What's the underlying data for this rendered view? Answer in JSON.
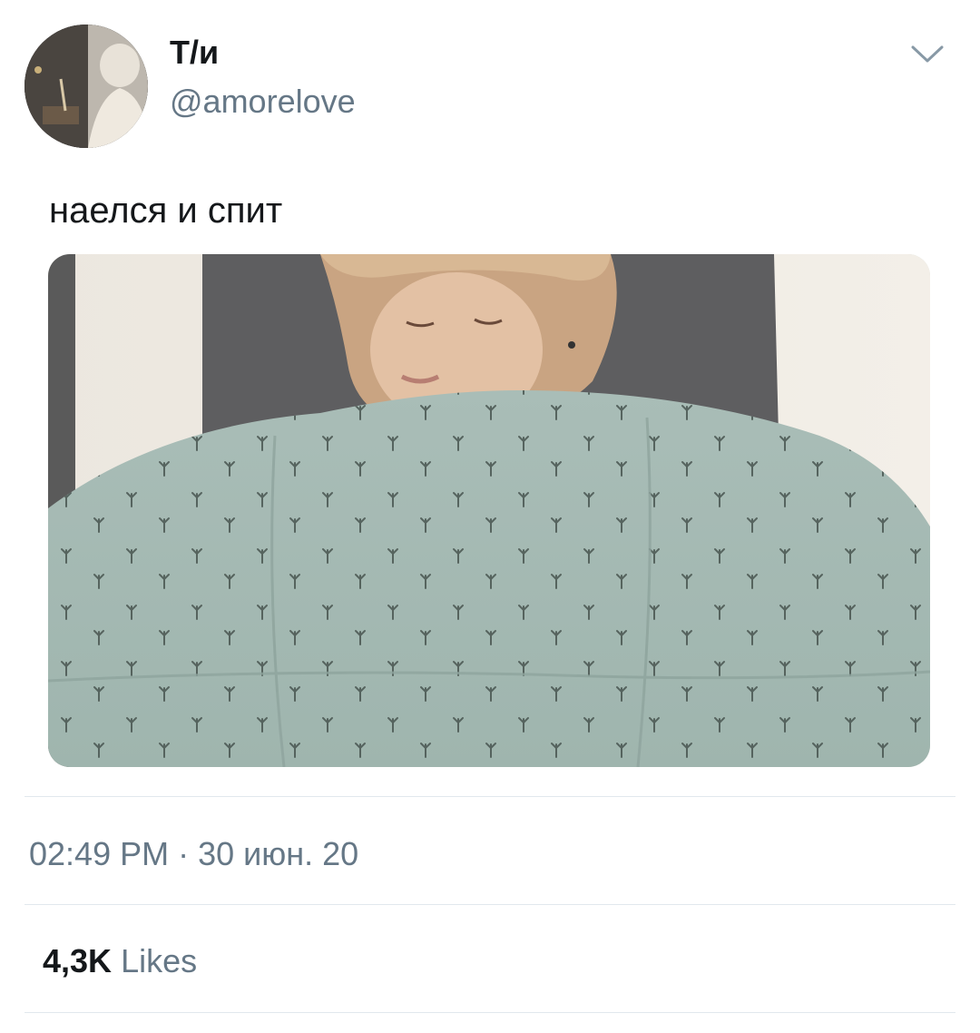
{
  "author": {
    "display_name": "Т/и",
    "handle": "@amorelove",
    "avatar_icon": "profile-photo"
  },
  "menu": {
    "icon": "chevron-down-icon"
  },
  "tweet": {
    "text": "наелся и спит",
    "media_icon": "photo"
  },
  "meta": {
    "timestamp": "02:49 PM · 30 июн. 20"
  },
  "stats": {
    "likes_count": "4,3K",
    "likes_label": "Likes"
  },
  "colors": {
    "text": "#14171a",
    "secondary": "#657786",
    "divider": "#e1e8ed"
  }
}
